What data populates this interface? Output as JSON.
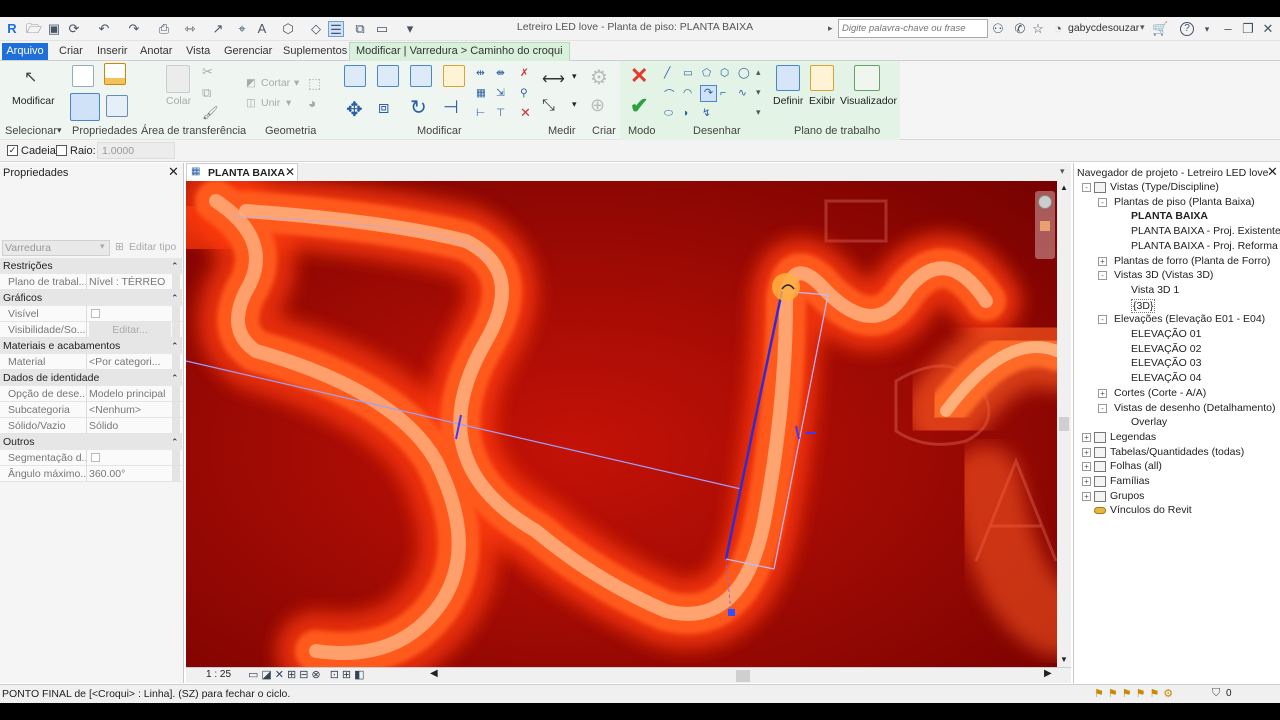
{
  "window": {
    "title": "Letreiro LED love - Planta de piso: PLANTA BAIXA",
    "search_placeholder": "Digite palavra-chave ou frase",
    "user": "gabycdesouzar"
  },
  "tabs": [
    "Arquivo",
    "Criar",
    "Inserir",
    "Anotar",
    "Vista",
    "Gerenciar",
    "Suplementos",
    "Modificar | Varredura > Caminho do croqui"
  ],
  "ribbon": {
    "modify_label": "Modificar",
    "cut_label": "Cortar",
    "join_label": "Unir",
    "paste_label": "Colar",
    "panels": [
      "Selecionar",
      "Propriedades",
      "Área de transferência",
      "Geometria",
      "Modificar",
      "Medir",
      "Criar",
      "Modo",
      "Desenhar",
      "Plano de trabalho"
    ],
    "workplane_buttons": [
      "Definir",
      "Exibir",
      "Visualizador"
    ]
  },
  "options_bar": {
    "chain_label": "Cadeia",
    "chain_checked": true,
    "radius_label": "Raio:",
    "radius_checked": false,
    "radius_value": "1.0000"
  },
  "properties": {
    "title": "Propriedades",
    "type_selector": "Varredura",
    "edit_type": "Editar tipo",
    "rows": [
      {
        "kind": "section",
        "label": "Restrições"
      },
      {
        "kind": "row",
        "label": "Plano de trabal...",
        "value": "Nível : TÉRREO"
      },
      {
        "kind": "section",
        "label": "Gráficos"
      },
      {
        "kind": "row",
        "label": "Visível",
        "value": ""
      },
      {
        "kind": "row",
        "label": "Visibilidade/So...",
        "value": "Editar..."
      },
      {
        "kind": "section",
        "label": "Materiais e acabamentos"
      },
      {
        "kind": "row",
        "label": "Material",
        "value": "<Por categori..."
      },
      {
        "kind": "section",
        "label": "Dados de identidade"
      },
      {
        "kind": "row",
        "label": "Opção de dese...",
        "value": "Modelo principal"
      },
      {
        "kind": "row",
        "label": "Subcategoria",
        "value": "<Nenhum>"
      },
      {
        "kind": "row",
        "label": "Sólido/Vazio",
        "value": "Sólido"
      },
      {
        "kind": "section",
        "label": "Outros"
      },
      {
        "kind": "row",
        "label": "Segmentação d...",
        "value": ""
      },
      {
        "kind": "row",
        "label": "Ângulo máximo...",
        "value": "360.00°"
      }
    ]
  },
  "view": {
    "tab_label": "PLANTA BAIXA",
    "scale": "1 : 25"
  },
  "navigator": {
    "title": "Navegador de projeto - Letreiro LED love",
    "items": [
      {
        "label": "Vistas (Type/Discipline)",
        "level": 0,
        "exp": "-",
        "icon": true,
        "bold": false
      },
      {
        "label": "Plantas de piso (Planta Baixa)",
        "level": 1,
        "exp": "-",
        "icon": false,
        "bold": false
      },
      {
        "label": "PLANTA BAIXA",
        "level": 2,
        "exp": "",
        "icon": false,
        "bold": true
      },
      {
        "label": "PLANTA BAIXA - Proj. Existente",
        "level": 2,
        "exp": "",
        "icon": false,
        "bold": false
      },
      {
        "label": "PLANTA BAIXA - Proj. Reforma",
        "level": 2,
        "exp": "",
        "icon": false,
        "bold": false
      },
      {
        "label": "Plantas de forro (Planta de Forro)",
        "level": 1,
        "exp": "+",
        "icon": false,
        "bold": false
      },
      {
        "label": "Vistas 3D (Vistas 3D)",
        "level": 1,
        "exp": "-",
        "icon": false,
        "bold": false
      },
      {
        "label": "Vista 3D 1",
        "level": 2,
        "exp": "",
        "icon": false,
        "bold": false
      },
      {
        "label": "{3D}",
        "level": 2,
        "exp": "",
        "icon": false,
        "bold": false
      },
      {
        "label": "Elevações (Elevação E01 - E04)",
        "level": 1,
        "exp": "-",
        "icon": false,
        "bold": false
      },
      {
        "label": "ELEVAÇÃO 01",
        "level": 2,
        "exp": "",
        "icon": false,
        "bold": false
      },
      {
        "label": "ELEVAÇÃO 02",
        "level": 2,
        "exp": "",
        "icon": false,
        "bold": false
      },
      {
        "label": "ELEVAÇÃO 03",
        "level": 2,
        "exp": "",
        "icon": false,
        "bold": false
      },
      {
        "label": "ELEVAÇÃO 04",
        "level": 2,
        "exp": "",
        "icon": false,
        "bold": false
      },
      {
        "label": "Cortes (Corte - A/A)",
        "level": 1,
        "exp": "+",
        "icon": false,
        "bold": false
      },
      {
        "label": "Vistas de desenho (Detalhamento)",
        "level": 1,
        "exp": "-",
        "icon": false,
        "bold": false
      },
      {
        "label": "Overlay",
        "level": 2,
        "exp": "",
        "icon": false,
        "bold": false
      },
      {
        "label": "Legendas",
        "level": 0,
        "exp": "+",
        "icon": true,
        "bold": false
      },
      {
        "label": "Tabelas/Quantidades (todas)",
        "level": 0,
        "exp": "+",
        "icon": true,
        "bold": false
      },
      {
        "label": "Folhas (all)",
        "level": 0,
        "exp": "+",
        "icon": true,
        "bold": false
      },
      {
        "label": "Famílias",
        "level": 0,
        "exp": "+",
        "icon": true,
        "bold": false
      },
      {
        "label": "Grupos",
        "level": 0,
        "exp": "+",
        "icon": true,
        "bold": false
      },
      {
        "label": "Vínculos do Revit",
        "level": 0,
        "exp": "",
        "icon": true,
        "bold": false
      }
    ]
  },
  "status": {
    "text": "PONTO FINAL de [<Croqui> : Linha].  (SZ) para fechar o ciclo.",
    "filter_count": "0"
  },
  "colors": {
    "accent": "#1e6fd9",
    "neon_glow": "#ff4a1c",
    "neon_core": "#ffd0a0",
    "background": "#8c0000",
    "sketch_line": "#2c2cd8"
  }
}
